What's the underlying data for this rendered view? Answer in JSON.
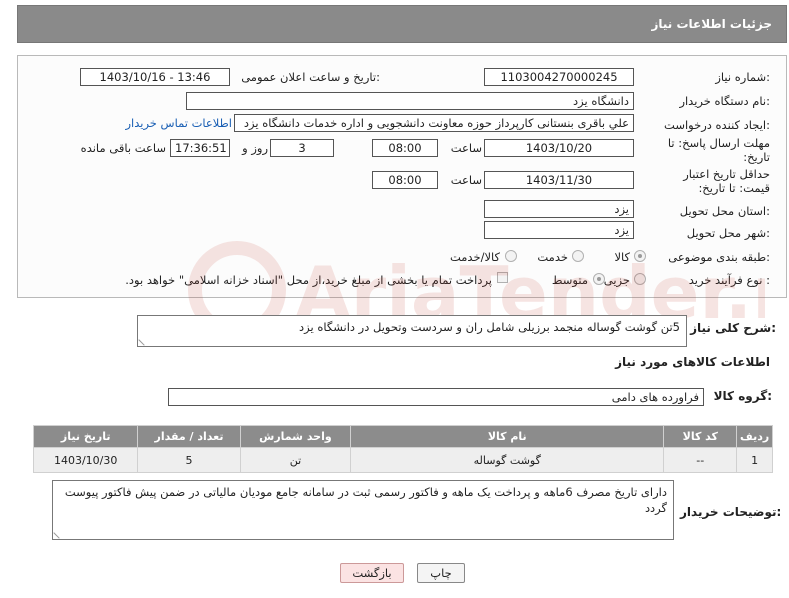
{
  "header": {
    "title": "جزئیات اطلاعات نیاز"
  },
  "form": {
    "need_number": {
      "label": "شماره نیاز:",
      "value": "1103004270000245"
    },
    "announce_datetime": {
      "label": "تاریخ و ساعت اعلان عمومی:",
      "value": "1403/10/16 - 13:46"
    },
    "buyer_org": {
      "label": "نام دستگاه خریدار:",
      "value": "دانشگاه یزد"
    },
    "requester": {
      "label": "ایجاد کننده درخواست:",
      "value": "علي باقری بنستانی کارپرداز حوزه معاونت دانشجویی و اداره خدمات دانشگاه یزد",
      "contact_link": "اطلاعات تماس خریدار"
    },
    "reply_deadline": {
      "label": "مهلت ارسال پاسخ: تا تاریخ:",
      "date": "1403/10/20",
      "time_label": "ساعت",
      "time": "08:00",
      "days": "3",
      "days_label": "روز و",
      "remaining": "17:36:51",
      "remaining_label": "ساعت باقی مانده"
    },
    "price_validity": {
      "label": "حداقل تاریخ اعتبار قیمت: تا تاریخ:",
      "date": "1403/11/30",
      "time_label": "ساعت",
      "time": "08:00"
    },
    "delivery_province": {
      "label": "استان محل تحویل:",
      "value": "یزد"
    },
    "delivery_city": {
      "label": "شهر محل تحویل:",
      "value": "یزد"
    },
    "category": {
      "label": "طبقه بندی موضوعی:",
      "options": [
        "کالا",
        "خدمت",
        "کالا/خدمت"
      ],
      "selected": "کالا"
    },
    "purchase_type": {
      "label": "نوع فرآیند خرید :",
      "options": [
        "جزیی",
        "متوسط"
      ],
      "selected": "متوسط",
      "payment_note": "پرداخت تمام یا بخشی از مبلغ خرید،از محل \"اسناد خزانه اسلامی\" خواهد بود."
    }
  },
  "summary": {
    "label": "شرح کلی نیاز:",
    "value": "5تن گوشت گوساله  منجمد برزیلی شامل ران و سردست وتحویل در دانشگاه یزد"
  },
  "goods_section": {
    "title": "اطلاعات کالاهای مورد نیاز",
    "group_label": "گروه کالا:",
    "group_value": "فراورده های دامی"
  },
  "items_table": {
    "headers": [
      "ردیف",
      "کد کالا",
      "نام کالا",
      "واحد شمارش",
      "تعداد / مقدار",
      "تاریخ نیاز"
    ],
    "rows": [
      [
        "1",
        "--",
        "گوشت گوساله",
        "تن",
        "5",
        "1403/10/30"
      ]
    ]
  },
  "buyer_notes": {
    "label": "توضیحات خریدار:",
    "value": "دارای تاریخ مصرف 6ماهه  و پرداخت یک ماهه و فاکتور رسمی ثبت در سامانه جامع مودیان مالیاتی در ضمن پیش فاکتور پیوست گردد"
  },
  "buttons": {
    "print": "چاپ",
    "back": "بازگشت"
  },
  "watermark": {
    "text": "AriaTender.neT"
  }
}
